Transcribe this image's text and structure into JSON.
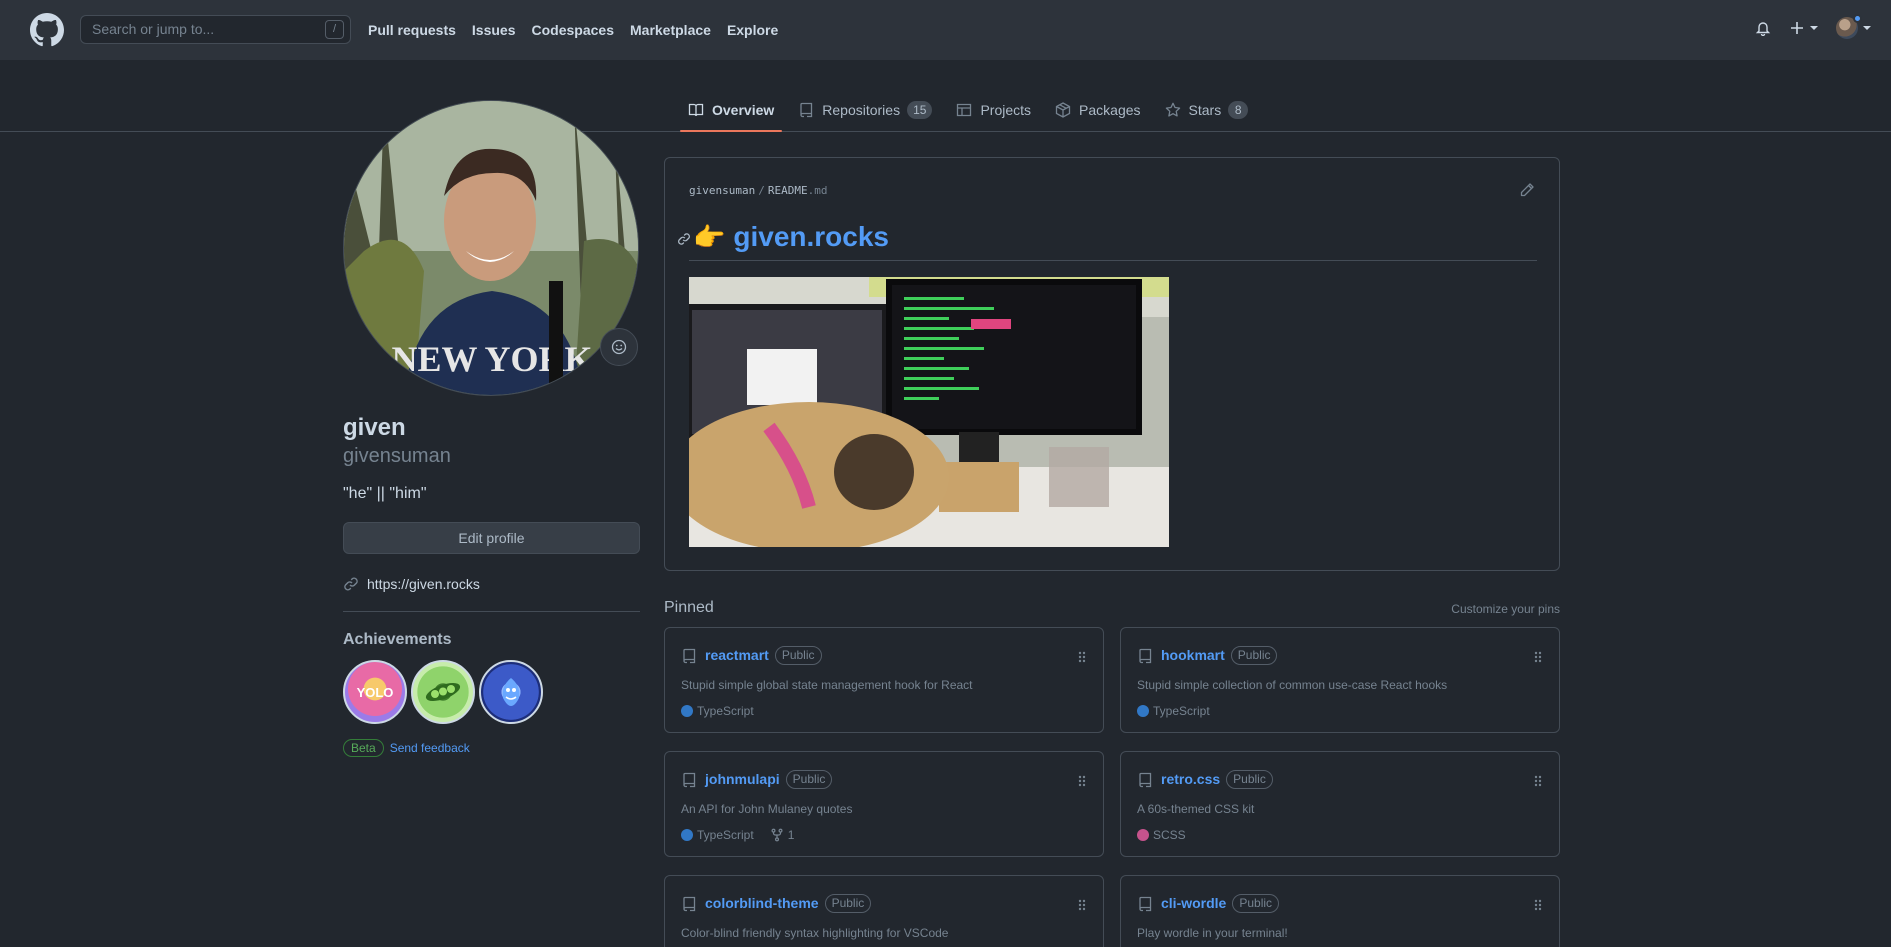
{
  "header": {
    "search_placeholder": "Search or jump to...",
    "search_shortcut": "/",
    "nav": [
      "Pull requests",
      "Issues",
      "Codespaces",
      "Marketplace",
      "Explore"
    ]
  },
  "tabs": [
    {
      "label": "Overview",
      "count": null,
      "active": true
    },
    {
      "label": "Repositories",
      "count": "15",
      "active": false
    },
    {
      "label": "Projects",
      "count": null,
      "active": false
    },
    {
      "label": "Packages",
      "count": null,
      "active": false
    },
    {
      "label": "Stars",
      "count": "8",
      "active": false
    }
  ],
  "profile": {
    "name": "given",
    "login": "givensuman",
    "bio": "\"he\" || \"him\"",
    "edit_label": "Edit profile",
    "website": "https://given.rocks",
    "achievements_title": "Achievements",
    "badges": [
      {
        "name": "YOLO",
        "text": "YOLO",
        "color": "#e86aa6"
      },
      {
        "name": "Pair Extraordinaire",
        "text": "",
        "color": "#6cbf4a"
      },
      {
        "name": "Pull Shark",
        "text": "",
        "color": "#3c5ac8"
      }
    ],
    "beta_label": "Beta",
    "feedback_label": "Send feedback"
  },
  "readme": {
    "owner": "givensuman",
    "file": "README",
    "ext": ".md",
    "hand": "👉",
    "title": "given.rocks"
  },
  "pinned": {
    "label": "Pinned",
    "customize_label": "Customize your pins",
    "repos": [
      {
        "name": "reactmart",
        "visibility": "Public",
        "desc": "Stupid simple global state management hook for React",
        "lang": "TypeScript",
        "lang_color": "#3178c6",
        "forks": null
      },
      {
        "name": "hookmart",
        "visibility": "Public",
        "desc": "Stupid simple collection of common use-case React hooks",
        "lang": "TypeScript",
        "lang_color": "#3178c6",
        "forks": null
      },
      {
        "name": "johnmulapi",
        "visibility": "Public",
        "desc": "An API for John Mulaney quotes",
        "lang": "TypeScript",
        "lang_color": "#3178c6",
        "forks": "1"
      },
      {
        "name": "retro.css",
        "visibility": "Public",
        "desc": "A 60s-themed CSS kit",
        "lang": "SCSS",
        "lang_color": "#c6538c",
        "forks": null
      },
      {
        "name": "colorblind-theme",
        "visibility": "Public",
        "desc": "Color-blind friendly syntax highlighting for VSCode",
        "lang": null,
        "lang_color": null,
        "forks": null
      },
      {
        "name": "cli-wordle",
        "visibility": "Public",
        "desc": "Play wordle in your terminal!",
        "lang": null,
        "lang_color": null,
        "forks": null
      }
    ]
  },
  "colors": {
    "accent": "#539bf5",
    "tab_underline": "#ec775c",
    "bg": "#22272e",
    "header_bg": "#2d333b"
  }
}
